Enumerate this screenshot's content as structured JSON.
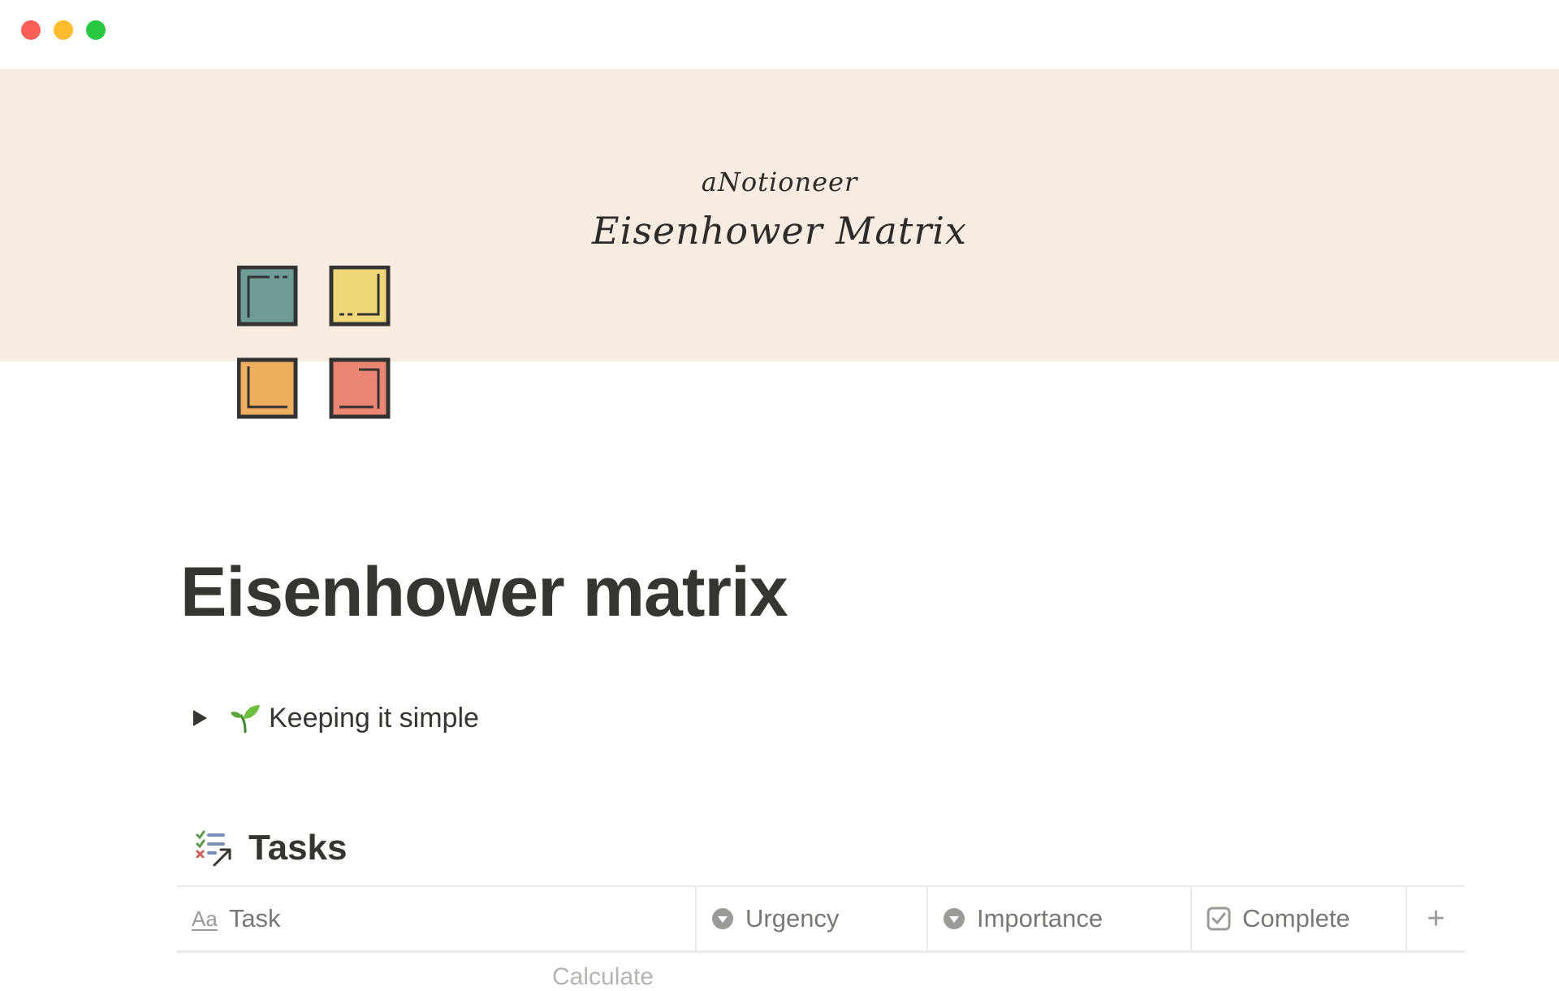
{
  "window": {
    "buttons": [
      "close",
      "minimize",
      "maximize"
    ]
  },
  "cover": {
    "brand": "aNotioneer",
    "title": "Eisenhower Matrix",
    "background": "#f7ebe2"
  },
  "page_icon": {
    "name": "eisenhower-matrix-icon",
    "colors": [
      "#6d9c97",
      "#f0d77a",
      "#f0ae5f",
      "#ea8671"
    ]
  },
  "page": {
    "title": "Eisenhower matrix"
  },
  "toggle": {
    "icon": "seedling-icon",
    "label": "Keeping it simple",
    "expanded": false
  },
  "tasks": {
    "icon": "checklist-icon",
    "title": "Tasks",
    "columns": [
      {
        "label": "Task",
        "icon": "text-property-icon"
      },
      {
        "label": "Urgency",
        "icon": "select-property-icon"
      },
      {
        "label": "Importance",
        "icon": "select-property-icon"
      },
      {
        "label": "Complete",
        "icon": "checkbox-property-icon"
      }
    ],
    "add_column_label": "+",
    "footer_peek": "Calculate"
  }
}
